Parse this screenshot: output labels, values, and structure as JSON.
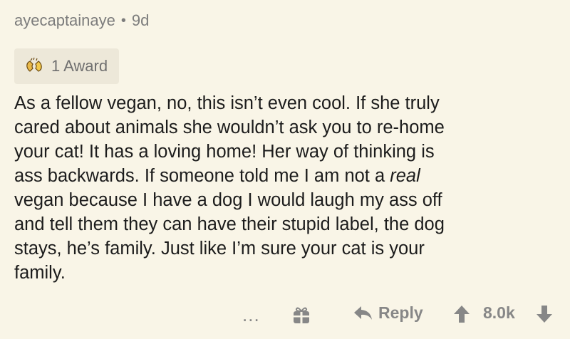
{
  "comment": {
    "author": "ayecaptainaye",
    "separator": "•",
    "age": "9d",
    "award": {
      "icon": "award-hands-icon",
      "label": "1 Award"
    },
    "body_lines": [
      "As a fellow vegan, no, this isn’t even cool. If she truly",
      "cared about animals she wouldn’t ask you to re-home",
      "your cat! It has a loving home! Her way of thinking is",
      "ass backwards. If someone told me I am not a ",
      "vegan because I have a dog I would laugh my ass off",
      "and tell them they can have their stupid label, the dog",
      "stays, he’s family. Just like I’m sure your cat is your",
      "family."
    ],
    "italic_word": "real"
  },
  "actions": {
    "more_label": "...",
    "gift_icon": "gift-icon",
    "reply_icon": "reply-arrow-icon",
    "reply_label": "Reply",
    "upvote_icon": "upvote-arrow-icon",
    "score": "8.0k",
    "downvote_icon": "downvote-arrow-icon"
  },
  "colors": {
    "background": "#f9f5e7",
    "meta_text": "#7c7c7c",
    "award_bg": "#ede8d9",
    "body_text": "#1c1c1c",
    "action_grey": "#878787"
  }
}
